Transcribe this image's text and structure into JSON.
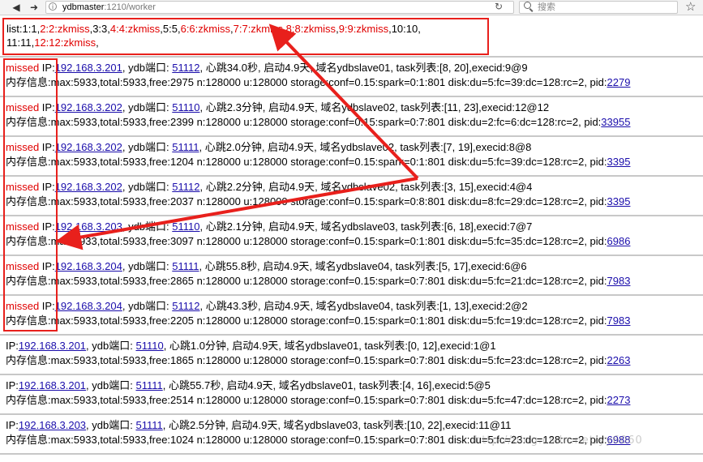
{
  "browser": {
    "url_host": "ydbmaster",
    "url_rest": ":1210/worker",
    "search_placeholder": "搜索"
  },
  "list_line": {
    "row1": [
      {
        "text": "list:1:1,",
        "missed": false
      },
      {
        "text": "2:2:zkmiss",
        "missed": true
      },
      {
        "text": ",3:3,",
        "missed": false
      },
      {
        "text": "4:4:zkmiss",
        "missed": true
      },
      {
        "text": ",5:5,",
        "missed": false
      },
      {
        "text": "6:6:zkmiss",
        "missed": true
      },
      {
        "text": ",",
        "missed": false
      },
      {
        "text": "7:7:zkmiss",
        "missed": true
      },
      {
        "text": ",",
        "missed": false
      },
      {
        "text": "8:8:zkmiss",
        "missed": true
      },
      {
        "text": ",",
        "missed": false
      },
      {
        "text": "9:9:zkmiss",
        "missed": true
      },
      {
        "text": ",10:10,",
        "missed": false
      }
    ],
    "row2": [
      {
        "text": "11:11,",
        "missed": false
      },
      {
        "text": "12:12:zkmiss",
        "missed": true
      },
      {
        "text": ",",
        "missed": false
      }
    ]
  },
  "entries": [
    {
      "missed": "missed ",
      "ip_label": "IP:",
      "ip": "192.168.3.201",
      "port_label": ", ydb端口: ",
      "port": "51112",
      "status": ", 心跳34.0秒, 启动4.9天, 域名ydbslave01, task列表:[8, 20],execid:9@9",
      "mem": "内存信息:max:5933,total:5933,free:2975 n:128000 u:128000 storage:conf=0.15:spark=0:1:801 disk:du=5:fc=39:dc=128:rc=2, pid:",
      "pid": "2279"
    },
    {
      "missed": "missed ",
      "ip_label": "IP:",
      "ip": "192.168.3.202",
      "port_label": ", ydb端口: ",
      "port": "51110",
      "status": ", 心跳2.3分钟, 启动4.9天, 域名ydbslave02, task列表:[11, 23],execid:12@12",
      "mem": "内存信息:max:5933,total:5933,free:2399 n:128000 u:128000 storage:conf=0.15:spark=0:7:801 disk:du=2:fc=6:dc=128:rc=2, pid:",
      "pid": "33955"
    },
    {
      "missed": "missed ",
      "ip_label": "IP:",
      "ip": "192.168.3.202",
      "port_label": ", ydb端口: ",
      "port": "51111",
      "status": ", 心跳2.0分钟, 启动4.9天, 域名ydbslave02, task列表:[7, 19],execid:8@8",
      "mem": "内存信息:max:5933,total:5933,free:1204 n:128000 u:128000 storage:conf=0.15:spark=0:1:801 disk:du=5:fc=39:dc=128:rc=2, pid:",
      "pid": "3395"
    },
    {
      "missed": "missed ",
      "ip_label": "IP:",
      "ip": "192.168.3.202",
      "port_label": ", ydb端口: ",
      "port": "51112",
      "status": ", 心跳2.2分钟, 启动4.9天, 域名ydbslave02, task列表:[3, 15],execid:4@4",
      "mem": "内存信息:max:5933,total:5933,free:2037 n:128000 u:128000 storage:conf=0.15:spark=0:8:801 disk:du=8:fc=29:dc=128:rc=2, pid:",
      "pid": "3395"
    },
    {
      "missed": "missed ",
      "ip_label": "IP:",
      "ip": "192.168.3.203",
      "port_label": ", ydb端口: ",
      "port": "51110",
      "status": ", 心跳2.1分钟, 启动4.9天, 域名ydbslave03, task列表:[6, 18],execid:7@7",
      "mem": "内存信息:max:5933,total:5933,free:3097 n:128000 u:128000 storage:conf=0.15:spark=0:1:801 disk:du=5:fc=35:dc=128:rc=2, pid:",
      "pid": "6986"
    },
    {
      "missed": "missed ",
      "ip_label": "IP:",
      "ip": "192.168.3.204",
      "port_label": ", ydb端口: ",
      "port": "51111",
      "status": ", 心跳55.8秒, 启动4.9天, 域名ydbslave04, task列表:[5, 17],execid:6@6",
      "mem": "内存信息:max:5933,total:5933,free:2865 n:128000 u:128000 storage:conf=0.15:spark=0:7:801 disk:du=5:fc=21:dc=128:rc=2, pid:",
      "pid": "7983"
    },
    {
      "missed": "missed ",
      "ip_label": "IP:",
      "ip": "192.168.3.204",
      "port_label": ", ydb端口: ",
      "port": "51112",
      "status": ", 心跳43.3秒, 启动4.9天, 域名ydbslave04, task列表:[1, 13],execid:2@2",
      "mem": "内存信息:max:5933,total:5933,free:2205 n:128000 u:128000 storage:conf=0.15:spark=0:1:801 disk:du=5:fc=19:dc=128:rc=2, pid:",
      "pid": "7983"
    },
    {
      "missed": "",
      "ip_label": "IP:",
      "ip": "192.168.3.201",
      "port_label": ", ydb端口: ",
      "port": "51110",
      "status": ", 心跳1.0分钟, 启动4.9天, 域名ydbslave01, task列表:[0, 12],execid:1@1",
      "mem": "内存信息:max:5933,total:5933,free:1865 n:128000 u:128000 storage:conf=0.15:spark=0:7:801 disk:du=5:fc=23:dc=128:rc=2, pid:",
      "pid": "2263"
    },
    {
      "missed": "",
      "ip_label": "IP:",
      "ip": "192.168.3.201",
      "port_label": ", ydb端口: ",
      "port": "51111",
      "status": ", 心跳55.7秒, 启动4.9天, 域名ydbslave01, task列表:[4, 16],execid:5@5",
      "mem": "内存信息:max:5933,total:5933,free:2514 n:128000 u:128000 storage:conf=0.15:spark=0:7:801 disk:du=5:fc=47:dc=128:rc=2, pid:",
      "pid": "2273"
    },
    {
      "missed": "",
      "ip_label": "IP:",
      "ip": "192.168.3.203",
      "port_label": ", ydb端口: ",
      "port": "51111",
      "status": ", 心跳2.5分钟, 启动4.9天, 域名ydbslave03, task列表:[10, 22],execid:11@11",
      "mem": "内存信息:max:5933,total:5933,free:1024 n:128000 u:128000 storage:conf=0.15:spark=0:7:801 disk:du=5:fc=23:dc=128:rc=2, pid:",
      "pid": "6988"
    }
  ],
  "watermark": "http://blog.csdn.net/yy6060",
  "colors": {
    "missed": "#e00000",
    "link": "#1a0dab",
    "annotation": "#e8201c"
  }
}
